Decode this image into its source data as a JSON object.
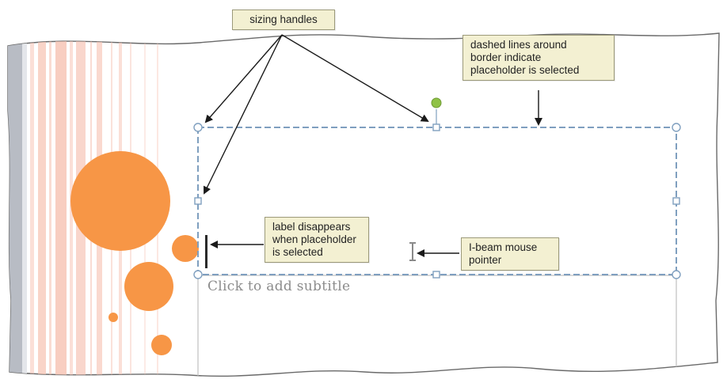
{
  "callouts": {
    "sizing_handles": {
      "line1": "sizing handles"
    },
    "dashed_lines": {
      "line1": "dashed lines around",
      "line2": "border indicate",
      "line3": "placeholder is selected"
    },
    "label_disappears": {
      "line1": "label disappears",
      "line2": "when placeholder",
      "line3": "is selected"
    },
    "ibeam": {
      "line1": "I-beam mouse",
      "line2": "pointer"
    }
  },
  "slide": {
    "subtitle_placeholder": "Click to add subtitle"
  },
  "colors": {
    "accent_orange": "#f79646",
    "selection_blue": "#7f9fbf",
    "rotation_handle": "#8fc246",
    "stripe_pink": "#f7c5b6",
    "callout_bg": "#f3f0d2"
  },
  "icons": {
    "rotation_handle": "rotation-handle-icon",
    "text_cursor": "text-insertion-cursor-icon",
    "ibeam_pointer": "ibeam-pointer-icon"
  }
}
